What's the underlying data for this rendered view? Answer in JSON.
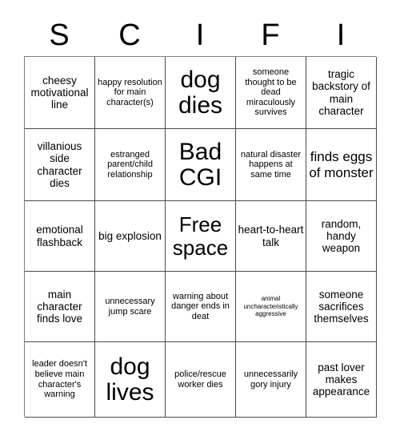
{
  "card": {
    "title_letters": [
      "S",
      "C",
      "I",
      "F",
      "I"
    ],
    "columns": 5,
    "rows": 5,
    "grid": [
      [
        {
          "text": "cheesy motivational line",
          "size": "md"
        },
        {
          "text": "happy resolution for main character(s)",
          "size": "sm"
        },
        {
          "text": "dog dies",
          "size": "xxl"
        },
        {
          "text": "someone thought to be dead miraculously survives",
          "size": "sm"
        },
        {
          "text": "tragic backstory of main character",
          "size": "md"
        }
      ],
      [
        {
          "text": "villanious side character dies",
          "size": "md"
        },
        {
          "text": "estranged parent/child relationship",
          "size": "sm"
        },
        {
          "text": "Bad CGI",
          "size": "xxl"
        },
        {
          "text": "natural disaster happens at same time",
          "size": "sm"
        },
        {
          "text": "finds eggs of monster",
          "size": "lg"
        }
      ],
      [
        {
          "text": "emotional flashback",
          "size": "md"
        },
        {
          "text": "big explosion",
          "size": "md"
        },
        {
          "text": "Free space",
          "size": "xl"
        },
        {
          "text": "heart-to-heart talk",
          "size": "md"
        },
        {
          "text": "random, handy weapon",
          "size": "md"
        }
      ],
      [
        {
          "text": "main character finds love",
          "size": "md"
        },
        {
          "text": "unnecessary jump scare",
          "size": "sm"
        },
        {
          "text": "warning about danger ends in deat",
          "size": "sm"
        },
        {
          "text": "animal uncharacteristically aggressive",
          "size": "xs"
        },
        {
          "text": "someone sacrifices themselves",
          "size": "md"
        }
      ],
      [
        {
          "text": "leader doesn't believe main character's warning",
          "size": "sm"
        },
        {
          "text": "dog lives",
          "size": "xxl"
        },
        {
          "text": "police/rescue worker dies",
          "size": "sm"
        },
        {
          "text": "unnecessarily gory injury",
          "size": "sm"
        },
        {
          "text": "past lover makes appearance",
          "size": "md"
        }
      ]
    ]
  },
  "colors": {
    "background": "#ffffff",
    "text": "#000000",
    "grid_border": "#4a4a4a",
    "outer_border": "#7d7d7d"
  }
}
